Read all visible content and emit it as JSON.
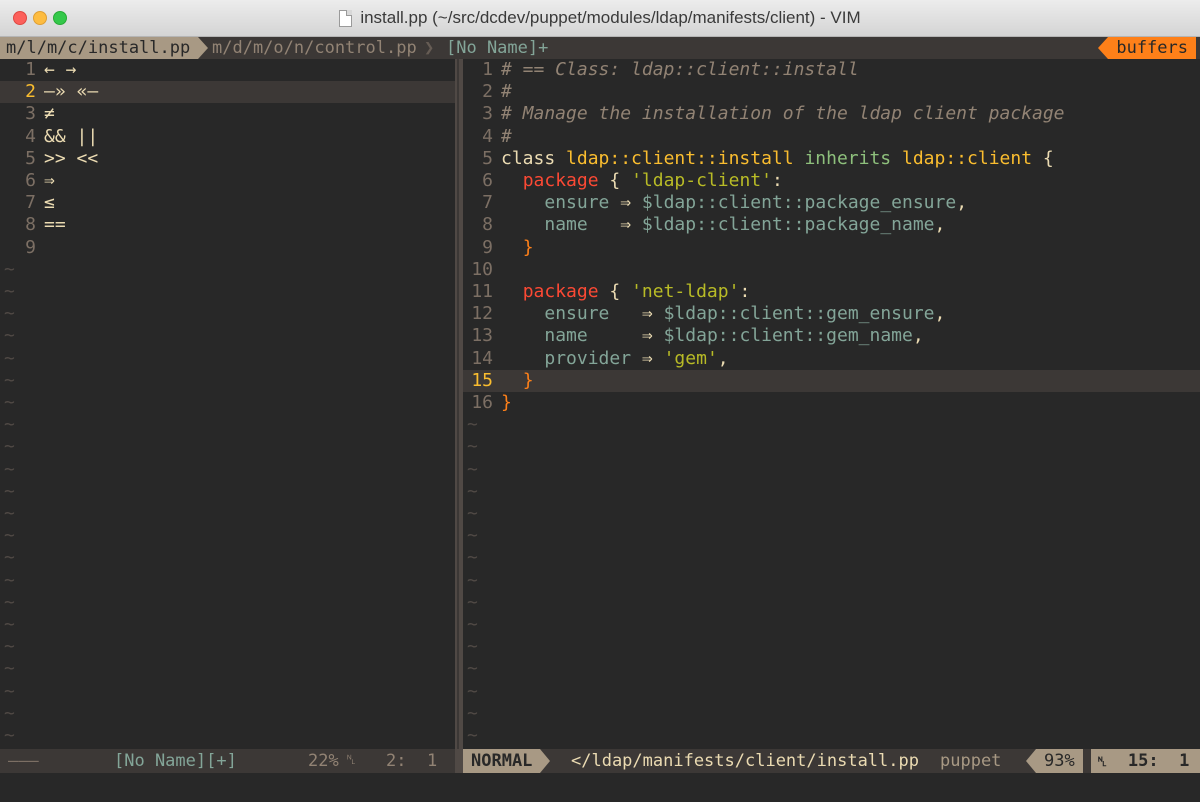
{
  "window": {
    "title": "install.pp (~/src/dcdev/puppet/modules/ldap/manifests/client) - VIM"
  },
  "tabline": {
    "tabs": [
      "m/l/m/c/install.pp",
      "m/d/m/o/n/control.pp",
      "[No Name]+"
    ],
    "buffers_label": "buffers"
  },
  "left_pane": {
    "lines": [
      {
        "num": "1",
        "text": "← →"
      },
      {
        "num": "2",
        "text": "—» «—"
      },
      {
        "num": "3",
        "text": "≠"
      },
      {
        "num": "4",
        "text": "&& ||"
      },
      {
        "num": "5",
        "text": ">> <<"
      },
      {
        "num": "6",
        "text": "⇒"
      },
      {
        "num": "7",
        "text": "≤"
      },
      {
        "num": "8",
        "text": "=="
      },
      {
        "num": "9",
        "text": ""
      }
    ],
    "cursor_line": 2,
    "tilde": "~"
  },
  "right_pane": {
    "lines": [
      {
        "num": "1"
      },
      {
        "num": "2"
      },
      {
        "num": "3"
      },
      {
        "num": "4"
      },
      {
        "num": "5"
      },
      {
        "num": "6"
      },
      {
        "num": "7"
      },
      {
        "num": "8"
      },
      {
        "num": "9"
      },
      {
        "num": "10"
      },
      {
        "num": "11"
      },
      {
        "num": "12"
      },
      {
        "num": "13"
      },
      {
        "num": "14"
      },
      {
        "num": "15"
      },
      {
        "num": "16"
      }
    ],
    "cursor_line": 15,
    "code": {
      "l1": "# == Class: ldap::client::install",
      "l2": "#",
      "l3": "# Manage the installation of the ldap client package",
      "l4": "#",
      "l5_kw": "class",
      "l5_name": "ldap::client::install",
      "l5_inh": "inherits",
      "l5_parent": "ldap::client",
      "l5_brace": "{",
      "l6_kw": "package",
      "l6_brace": "{",
      "l6_str": "'ldap-client'",
      "l6_colon": ":",
      "l7_attr": "ensure",
      "l7_arrow": "⇒",
      "l7_var": "$ldap::client::package_ensure",
      "l7_comma": ",",
      "l8_attr": "name",
      "l8_arrow": "⇒",
      "l8_var": "$ldap::client::package_name",
      "l8_comma": ",",
      "l9_brace": "}",
      "l11_kw": "package",
      "l11_brace": "{",
      "l11_str": "'net-ldap'",
      "l11_colon": ":",
      "l12_attr": "ensure",
      "l12_arrow": "⇒",
      "l12_var": "$ldap::client::gem_ensure",
      "l12_comma": ",",
      "l13_attr": "name",
      "l13_arrow": "⇒",
      "l13_var": "$ldap::client::gem_name",
      "l13_comma": ",",
      "l14_attr": "provider",
      "l14_arrow": "⇒",
      "l14_str": "'gem'",
      "l14_comma": ",",
      "l15_brace": "}",
      "l16_brace": "}"
    }
  },
  "statusline": {
    "left_dashes": "———",
    "left_name": "[No Name][+]",
    "left_pct": "22%",
    "left_ln_icon": "␤",
    "left_pos": "2:  1",
    "mode": "NORMAL",
    "path": "</ldap/manifests/client/install.pp",
    "filetype": "puppet",
    "pct": "93%",
    "ln_icon": "␤",
    "pos": "15:  1"
  },
  "colors": {
    "background": "#282828",
    "keyword": "#fb4934",
    "class_name": "#fabd2f",
    "string": "#b8bb26",
    "variable": "#83a598",
    "brace": "#fe8019",
    "comment": "#928374",
    "accent_tab": "#fe8019"
  }
}
